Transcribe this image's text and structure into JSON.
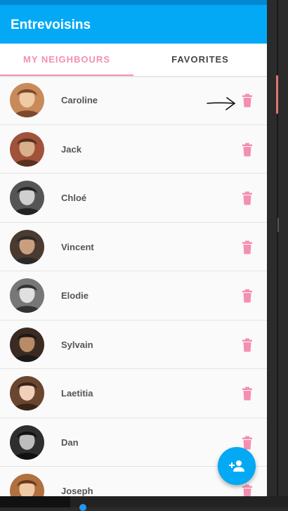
{
  "app": {
    "title": "Entrevoisins"
  },
  "tabs": [
    {
      "label": "MY NEIGHBOURS",
      "active": true
    },
    {
      "label": "FAVORITES",
      "active": false
    }
  ],
  "neighbours": [
    {
      "name": "Caroline"
    },
    {
      "name": "Jack"
    },
    {
      "name": "Chloé"
    },
    {
      "name": "Vincent"
    },
    {
      "name": "Elodie"
    },
    {
      "name": "Sylvain"
    },
    {
      "name": "Laetitia"
    },
    {
      "name": "Dan"
    },
    {
      "name": "Joseph"
    }
  ],
  "icons": {
    "delete": "trash-icon",
    "add": "add-person-icon",
    "annotation": "hand-drawn-arrow"
  },
  "colors": {
    "primary": "#03a9f4",
    "primary_dark": "#0288d1",
    "accent": "#f48fb1"
  }
}
